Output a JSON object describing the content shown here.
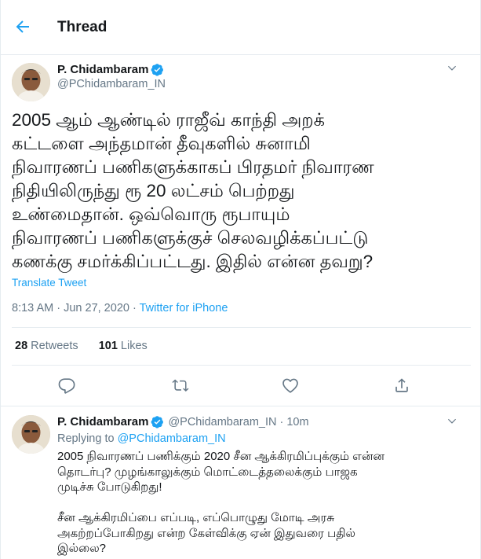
{
  "header": {
    "title": "Thread"
  },
  "main_tweet": {
    "author_name": "P. Chidambaram",
    "author_handle": "@PChidambaram_IN",
    "text_lines": [
      "2005 ஆம் ஆண்டில் ராஜீவ் காந்தி அறக்",
      "கட்டளை அந்தமான் தீவுகளில் சுனாமி",
      "நிவாரணப் பணிகளுக்காகப் பிரதமர் நிவாரண",
      "நிதியிலிருந்து ரூ 20 லட்சம் பெற்றது",
      "உண்மைதான். ஒவ்வொரு ரூபாயும்",
      "நிவாரணப் பணிகளுக்குச் செலவழிக்கப்பட்டு",
      "கணக்கு சமர்க்கிப்பட்டது. இதில் என்ன தவறு?"
    ],
    "translate_label": "Translate Tweet",
    "time": "8:13 AM",
    "date": "Jun 27, 2020",
    "source": "Twitter for iPhone",
    "retweets_count": "28",
    "retweets_label": "Retweets",
    "likes_count": "101",
    "likes_label": "Likes"
  },
  "reply": {
    "author_name": "P. Chidambaram",
    "author_handle": "@PChidambaram_IN",
    "time_ago": "10m",
    "replying_to_label": "Replying to",
    "replying_to_handle": "@PChidambaram_IN",
    "text_lines": [
      "2005 நிவாரணப் பணிக்கும் 2020 சீன ஆக்கிரமிப்புக்கும் என்ன",
      "தொடர்பு? முழங்காலுக்கும் மொட்டைத்தலைக்கும் பாஜக",
      "முடிச்சு போடுகிறது!",
      "",
      "சீன ஆக்கிரமிப்பை எப்படி, எப்பொழுது மோடி அரசு",
      "அகற்றப்போகிறது என்ற கேள்விக்கு ஏன் இதுவரை பதில்",
      "இல்லை?"
    ]
  },
  "icons": {
    "back": "back-arrow-icon",
    "verified": "verified-badge-icon",
    "caret": "chevron-down-icon",
    "reply": "reply-icon",
    "retweet": "retweet-icon",
    "like": "heart-icon",
    "share": "share-icon"
  },
  "colors": {
    "accent": "#1da1f2",
    "text_primary": "#14171a",
    "text_secondary": "#657786",
    "border": "#e6ecf0"
  }
}
